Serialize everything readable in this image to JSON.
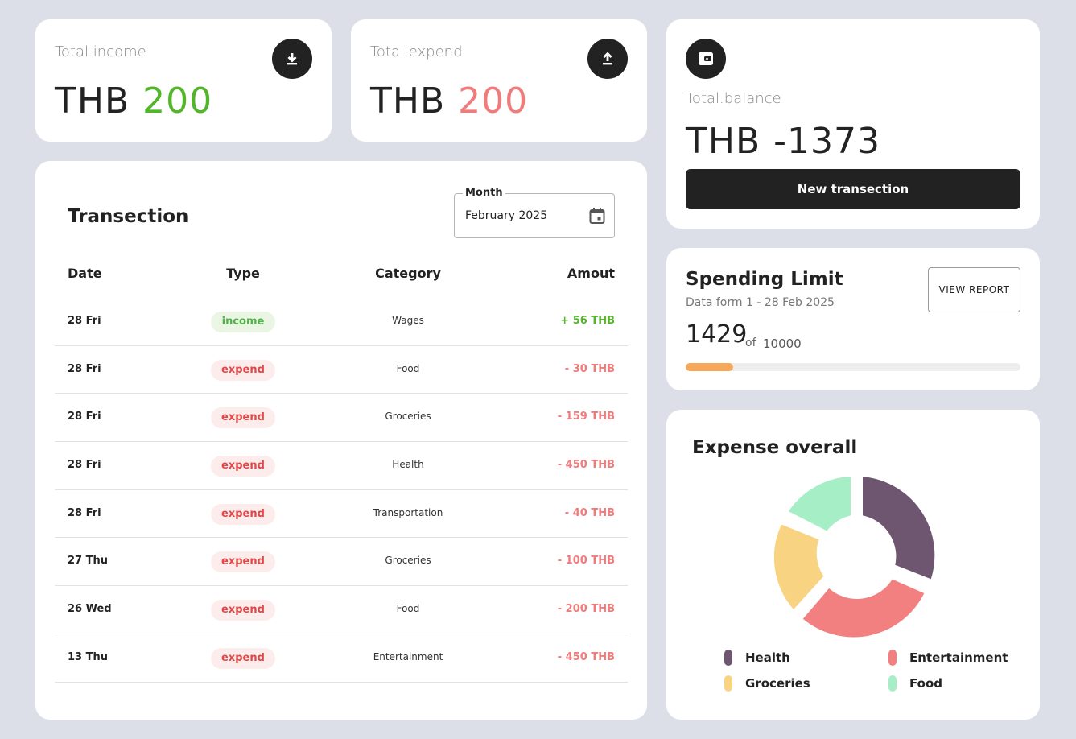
{
  "income": {
    "label": "Total.income",
    "currency": "THB",
    "value": "200",
    "icon": "download-icon"
  },
  "expend": {
    "label": "Total.expend",
    "currency": "THB",
    "value": "200",
    "icon": "upload-icon"
  },
  "balance": {
    "label": "Total.balance",
    "currency": "THB",
    "value": "-1373",
    "icon": "wallet-icon",
    "button": "New transection"
  },
  "transactions": {
    "title": "Transection",
    "month_label": "Month",
    "month_value": "February 2025",
    "headers": {
      "date": "Date",
      "type": "Type",
      "category": "Category",
      "amount": "Amout"
    },
    "rows": [
      {
        "date": "28 Fri",
        "type": "income",
        "category": "Wages",
        "amount": "+ 56 THB"
      },
      {
        "date": "28 Fri",
        "type": "expend",
        "category": "Food",
        "amount": "- 30 THB"
      },
      {
        "date": "28 Fri",
        "type": "expend",
        "category": "Groceries",
        "amount": "- 159 THB"
      },
      {
        "date": "28 Fri",
        "type": "expend",
        "category": "Health",
        "amount": "- 450 THB"
      },
      {
        "date": "28 Fri",
        "type": "expend",
        "category": "Transportation",
        "amount": "- 40 THB"
      },
      {
        "date": "27 Thu",
        "type": "expend",
        "category": "Groceries",
        "amount": "- 100 THB"
      },
      {
        "date": "26 Wed",
        "type": "expend",
        "category": "Food",
        "amount": "- 200 THB"
      },
      {
        "date": "13 Thu",
        "type": "expend",
        "category": "Entertainment",
        "amount": "- 450 THB"
      }
    ]
  },
  "spending": {
    "title": "Spending Limit",
    "subtitle": "Data form 1 - 28 Feb 2025",
    "button": "VIEW REPORT",
    "amount": "1429",
    "of": "of",
    "max": "10000",
    "progress_fraction": 0.1429
  },
  "expense": {
    "title": "Expense overall",
    "legend": [
      {
        "name": "Health",
        "color": "#6f5670"
      },
      {
        "name": "Entertainment",
        "color": "#f28080"
      },
      {
        "name": "Groceries",
        "color": "#f8d382"
      },
      {
        "name": "Food",
        "color": "#a6eec6"
      }
    ]
  },
  "colors": {
    "income": "#52b52a",
    "expend": "#f07b7b",
    "progress": "#f6a85a",
    "dark": "#222222"
  }
}
